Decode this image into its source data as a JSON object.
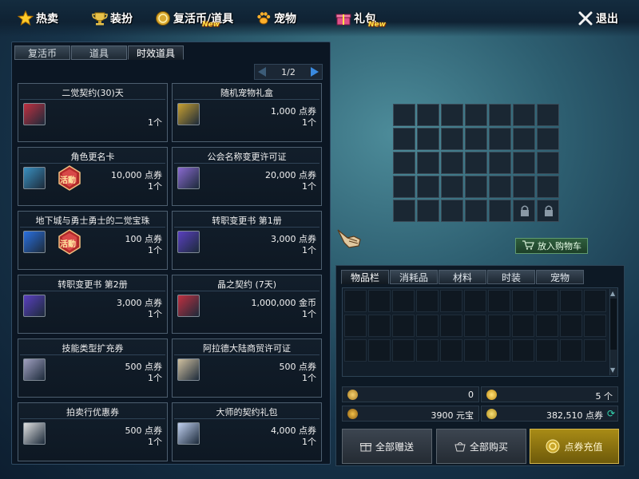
{
  "nav": {
    "hot_sale": "热卖",
    "costume": "装扮",
    "revive_coin_items": "复活币/道具",
    "pets": "宠物",
    "gift_pack": "礼包",
    "new_badge": "New",
    "exit": "退出"
  },
  "shop_tabs": [
    "复活币",
    "道具",
    "时效道具"
  ],
  "pager": {
    "current": "1",
    "separator": "/",
    "total": "2"
  },
  "items": [
    {
      "name": "二觉契约(30)天",
      "price": "",
      "qty": "1个",
      "icon": "contract-icon",
      "event": false
    },
    {
      "name": "随机宠物礼盒",
      "price": "1,000 点券",
      "qty": "1个",
      "icon": "pet-giftbox-icon",
      "event": false
    },
    {
      "name": "角色更名卡",
      "price": "10,000 点券",
      "qty": "1个",
      "icon": "rename-card-icon",
      "event": true
    },
    {
      "name": "公会名称变更许可证",
      "price": "20,000 点券",
      "qty": "1个",
      "icon": "guild-permit-icon",
      "event": false
    },
    {
      "name": "地下城与勇士勇士的二觉宝珠",
      "price": "100 点券",
      "qty": "1个",
      "icon": "orb-icon",
      "event": true
    },
    {
      "name": "转职变更书 第1册",
      "price": "3,000 点券",
      "qty": "1个",
      "icon": "job-book-icon",
      "event": false
    },
    {
      "name": "转职变更书 第2册",
      "price": "3,000 点券",
      "qty": "1个",
      "icon": "job-book-2-icon",
      "event": false
    },
    {
      "name": "晶之契约 (7天)",
      "price": "1,000,000 金币",
      "qty": "1个",
      "icon": "crystal-contract-icon",
      "event": false
    },
    {
      "name": "技能类型扩充券",
      "price": "500 点券",
      "qty": "1个",
      "icon": "skill-scroll-icon",
      "event": false
    },
    {
      "name": "阿拉德大陆商贸许可证",
      "price": "500 点券",
      "qty": "1个",
      "icon": "trade-permit-icon",
      "event": false
    },
    {
      "name": "拍卖行优惠券",
      "price": "500 点券",
      "qty": "1个",
      "icon": "auction-coupon-icon",
      "event": false
    },
    {
      "name": "大师的契约礼包",
      "price": "4,000 点券",
      "qty": "1个",
      "icon": "master-contract-icon",
      "event": false
    }
  ],
  "event_label": "活動",
  "preview": {
    "add_to_cart": "放入购物车"
  },
  "inventory": {
    "tabs": [
      "物品栏",
      "消耗品",
      "材料",
      "时装",
      "宠物"
    ]
  },
  "stats": {
    "stat_a": "0",
    "stat_b": "5 个",
    "stat_c": "3900 元宝",
    "stat_d": "382,510 点券"
  },
  "buttons": {
    "gift_all": "全部赠送",
    "buy_all": "全部购买",
    "recharge": "点券充值"
  },
  "colors": {
    "accent_gold": "#ffd24a",
    "new_badge": "#ffe14a",
    "cart_green": "#2f5e3d"
  }
}
